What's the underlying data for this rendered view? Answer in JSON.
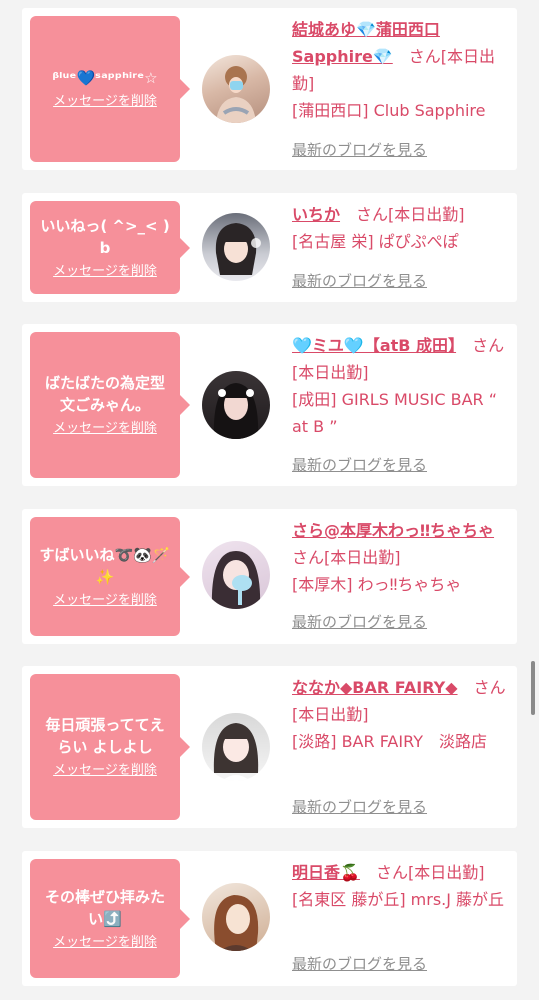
{
  "delete_label": "メッセージを削除",
  "blog_label": "最新のブログを見る",
  "colors": {
    "bubble": "#f6909a",
    "name": "#d94a68",
    "blog_link": "#8f8f8f",
    "card": "#ffffff",
    "page": "#f3f3f3"
  },
  "items": [
    {
      "message": "ᵝˡᵘᵉ💙ˢᵃᵖᵖʰⁱʳᵉ☆",
      "name": "結城あゆ💎蒲田西口Sapphire💎",
      "status": "さん[本日出勤]",
      "shop": "[蒲田西口] Club Sapphire"
    },
    {
      "message": "いいねっ( ^>_< )b",
      "name": "いちか",
      "status": "さん[本日出勤]",
      "shop": "[名古屋 栄] ぱぴぷぺぽ"
    },
    {
      "message": "ばたばたの為定型文ごみゃん。",
      "name": "🩵ミユ🩵【atB 成田】",
      "status": "さん[本日出勤]",
      "shop": "[成田] GIRLS MUSIC BAR “ at B ”"
    },
    {
      "message": "すばいいね➰🐼🪄✨",
      "name": "さら@本厚木わっ‼ちゃちゃ",
      "status": "さん[本日出勤]",
      "shop": "[本厚木] わっ‼ちゃちゃ"
    },
    {
      "message": "毎日頑張っててえらい よしよし",
      "name": "ななか◆BAR FAIRY◆",
      "status": "さん[本日出勤]",
      "shop": "[淡路] BAR FAIRY　淡路店"
    },
    {
      "message": "その棒ぜひ拝みたい⤴️",
      "name": "明日香🍒",
      "status": "さん[本日出勤]",
      "shop": "[名東区 藤が丘] mrs.J 藤が丘"
    }
  ]
}
